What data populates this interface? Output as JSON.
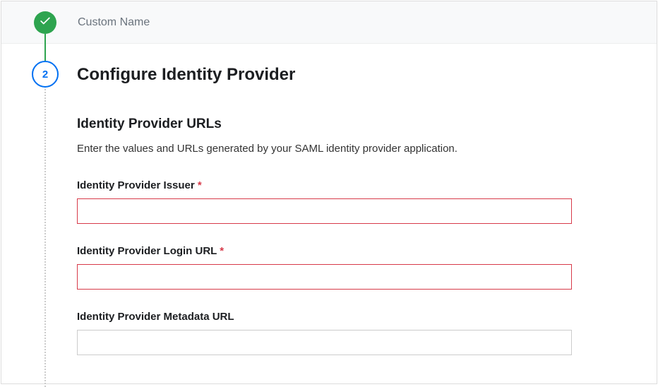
{
  "step1": {
    "label": "Custom Name"
  },
  "step2": {
    "number": "2",
    "title": "Configure Identity Provider",
    "section_title": "Identity Provider URLs",
    "section_desc": "Enter the values and URLs generated by your SAML identity provider application.",
    "fields": {
      "issuer": {
        "label": "Identity Provider Issuer ",
        "required": "*",
        "value": ""
      },
      "login_url": {
        "label": "Identity Provider Login URL ",
        "required": "*",
        "value": ""
      },
      "metadata_url": {
        "label": "Identity Provider Metadata URL",
        "value": ""
      }
    }
  }
}
